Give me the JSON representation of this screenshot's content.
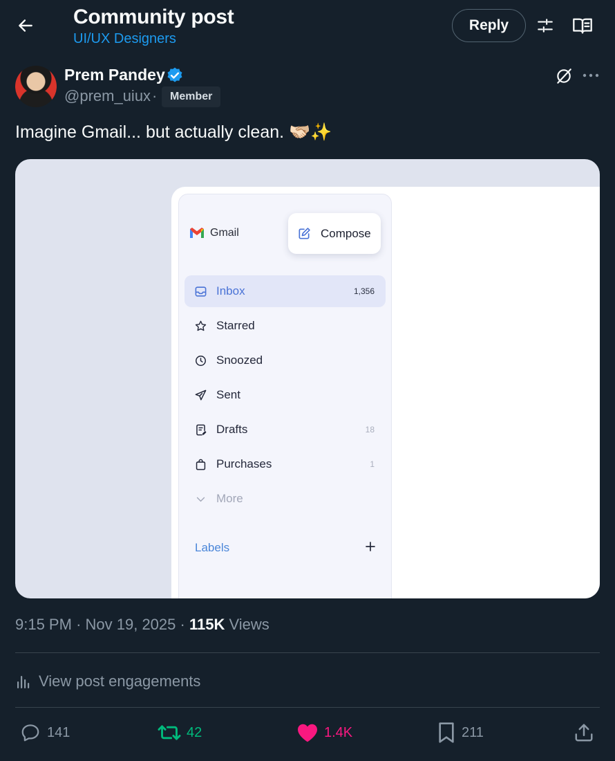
{
  "header": {
    "title": "Community post",
    "community": "UI/UX Designers",
    "reply_label": "Reply"
  },
  "author": {
    "name": "Prem Pandey",
    "handle": "@prem_uiux",
    "separator": "·",
    "badge": "Member"
  },
  "post": {
    "text": "Imagine Gmail... but actually clean. 🫱🏻‍🫲🏼✨"
  },
  "media": {
    "app_name": "Gmail",
    "compose_label": "Compose",
    "nav": [
      {
        "label": "Inbox",
        "count": "1,356",
        "icon": "inbox-icon"
      },
      {
        "label": "Starred",
        "count": "",
        "icon": "star-icon"
      },
      {
        "label": "Snoozed",
        "count": "",
        "icon": "clock-icon"
      },
      {
        "label": "Sent",
        "count": "",
        "icon": "send-icon"
      },
      {
        "label": "Drafts",
        "count": "18",
        "icon": "draft-icon"
      },
      {
        "label": "Purchases",
        "count": "1",
        "icon": "bag-icon"
      },
      {
        "label": "More",
        "count": "",
        "icon": "chevron-down-icon"
      }
    ],
    "labels_heading": "Labels"
  },
  "meta": {
    "time": "9:15 PM",
    "date": "Nov 19, 2025",
    "views_count": "115K",
    "views_label": "Views",
    "sep": "·"
  },
  "engagements_label": "View post engagements",
  "actions": {
    "replies": "141",
    "reposts": "42",
    "likes": "1.4K",
    "bookmarks": "211"
  },
  "colors": {
    "background": "#15202b",
    "accent": "#1d9bf0",
    "repost": "#00ba7c",
    "like": "#f91880",
    "muted": "#8b98a5"
  }
}
